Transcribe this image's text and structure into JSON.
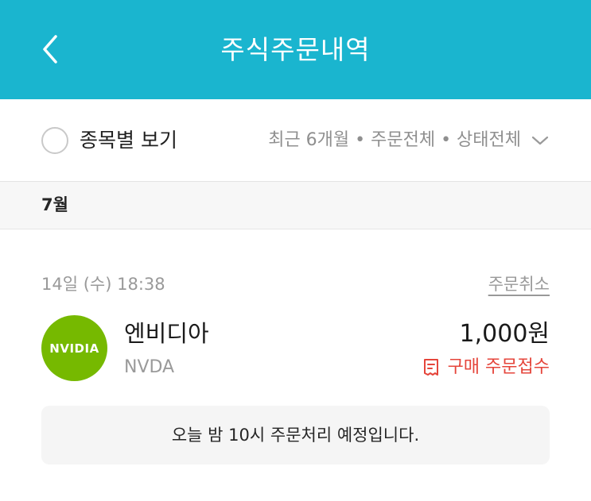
{
  "header": {
    "title": "주식주문내역",
    "back_icon": "chevron-left-icon",
    "background_color": "#1ab5cf"
  },
  "filters": {
    "toggle_label": "종목별 보기",
    "toggle_checked": false,
    "summary": "최근 6개월 • 주문전체 • 상태전체",
    "dropdown_icon": "chevron-down-icon"
  },
  "orders": {
    "month": "7월",
    "items": [
      {
        "date": "14일 (수) 18:38",
        "cancel_label": "주문취소",
        "logo_text": "NVIDIA",
        "logo_color": "#76b900",
        "name": "엔비디아",
        "ticker": "NVDA",
        "amount": "1,000원",
        "status_icon": "receipt-icon",
        "status": "구매 주문접수",
        "status_color": "#e5453b",
        "notice": "오늘 밤 10시 주문처리 예정입니다."
      }
    ]
  }
}
